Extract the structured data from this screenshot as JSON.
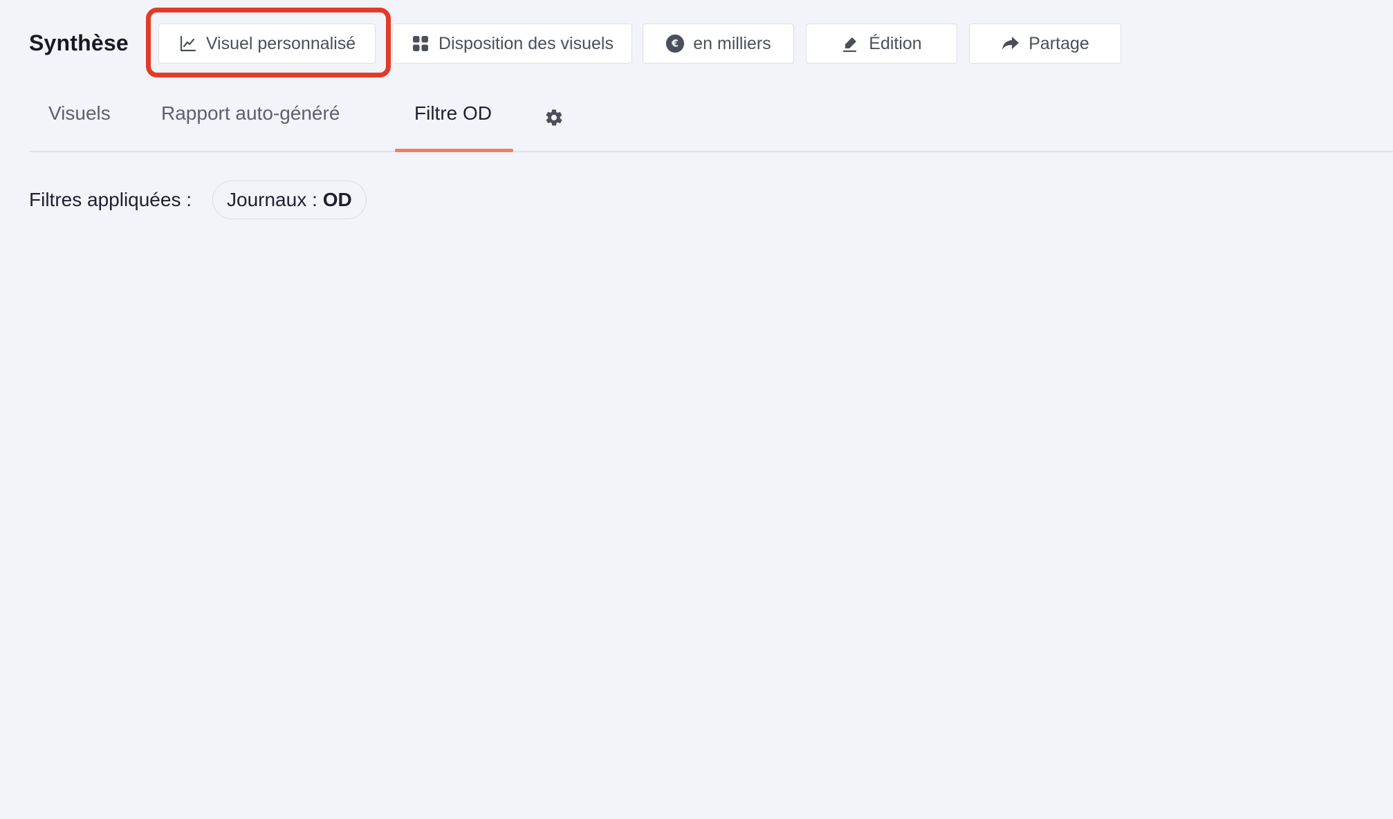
{
  "header": {
    "title": "Synthèse"
  },
  "toolbar": {
    "buttons": [
      {
        "label": "Visuel personnalisé",
        "icon": "line-chart-icon"
      },
      {
        "label": "Disposition des visuels",
        "icon": "grid-icon"
      },
      {
        "label": "en milliers",
        "icon": "euro-icon"
      },
      {
        "label": "Édition",
        "icon": "pen-icon"
      },
      {
        "label": "Partage",
        "icon": "share-icon"
      }
    ]
  },
  "tabs": {
    "items": [
      {
        "label": "Visuels",
        "active": false
      },
      {
        "label": "Rapport auto-généré",
        "active": false
      },
      {
        "label": "Filtre OD",
        "active": true
      }
    ],
    "settings_icon": "gear-icon",
    "accent_color": "#ef7e68"
  },
  "filters": {
    "label": "Filtres appliquées :",
    "chips": [
      {
        "key": "Journaux :",
        "value": "OD"
      }
    ]
  },
  "annotation": {
    "highlight_color": "#e23b28"
  }
}
